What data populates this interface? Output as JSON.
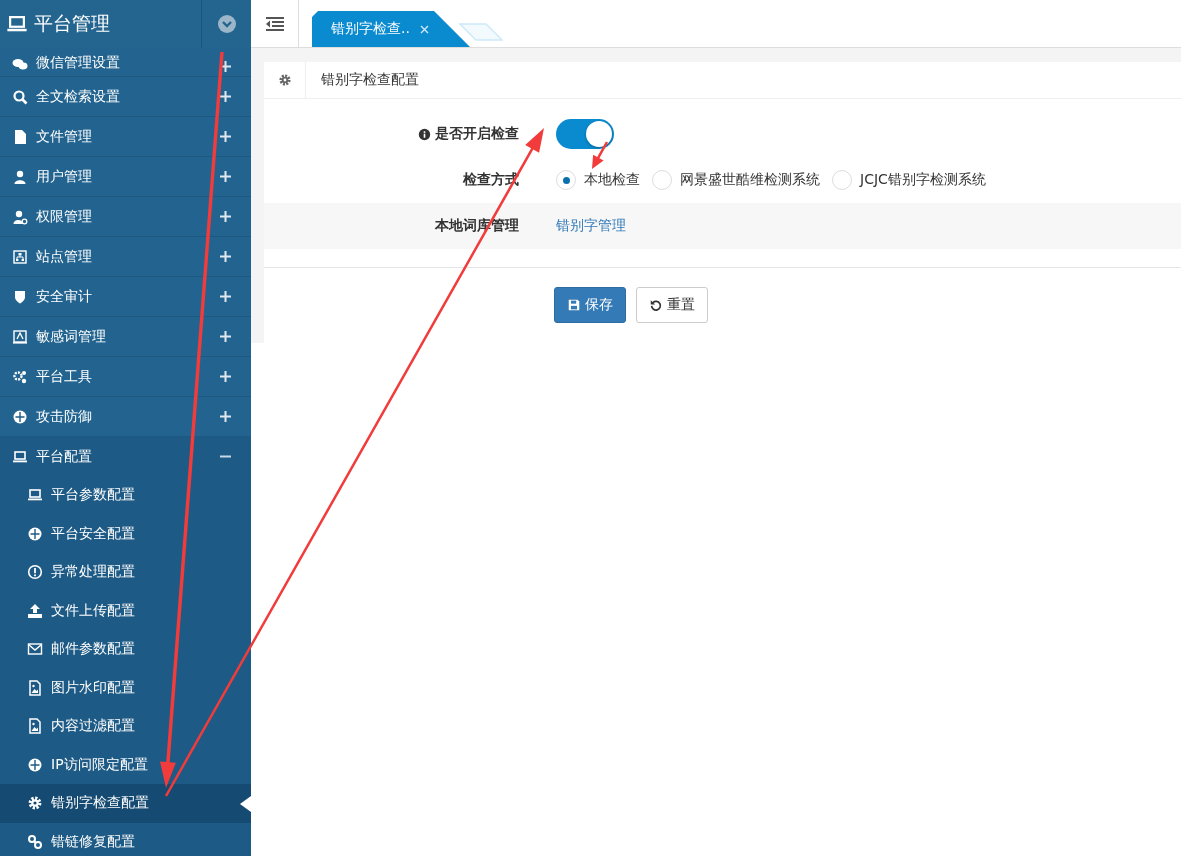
{
  "sidebar": {
    "title": "平台管理",
    "items": [
      {
        "label": "微信管理设置",
        "expanded": false
      },
      {
        "label": "全文检索设置",
        "expanded": false
      },
      {
        "label": "文件管理",
        "expanded": false
      },
      {
        "label": "用户管理",
        "expanded": false
      },
      {
        "label": "权限管理",
        "expanded": false
      },
      {
        "label": "站点管理",
        "expanded": false
      },
      {
        "label": "安全审计",
        "expanded": false
      },
      {
        "label": "敏感词管理",
        "expanded": false
      },
      {
        "label": "平台工具",
        "expanded": false
      },
      {
        "label": "攻击防御",
        "expanded": false
      },
      {
        "label": "平台配置",
        "expanded": true,
        "children": [
          {
            "label": "平台参数配置",
            "selected": false
          },
          {
            "label": "平台安全配置",
            "selected": false
          },
          {
            "label": "异常处理配置",
            "selected": false
          },
          {
            "label": "文件上传配置",
            "selected": false
          },
          {
            "label": "邮件参数配置",
            "selected": false
          },
          {
            "label": "图片水印配置",
            "selected": false
          },
          {
            "label": "内容过滤配置",
            "selected": false
          },
          {
            "label": "IP访问限定配置",
            "selected": false
          },
          {
            "label": "错别字检查配置",
            "selected": true
          },
          {
            "label": "错链修复配置",
            "selected": false
          }
        ]
      }
    ]
  },
  "tabs": [
    {
      "label": "错别字检查..",
      "selected": true
    }
  ],
  "panel": {
    "title": "错别字检查配置",
    "toggle": {
      "label": "是否开启检查",
      "on": true
    },
    "method": {
      "label": "检查方式",
      "options": [
        {
          "label": "本地检查",
          "selected": true
        },
        {
          "label": "网景盛世酷维检测系统",
          "selected": false
        },
        {
          "label": "JCJC错别字检测系统",
          "selected": false
        }
      ]
    },
    "dictionary": {
      "label": "本地词库管理",
      "link": "错别字管理"
    },
    "buttons": [
      {
        "kind": "save",
        "label": "保存"
      },
      {
        "kind": "reset",
        "label": "重置"
      }
    ]
  }
}
